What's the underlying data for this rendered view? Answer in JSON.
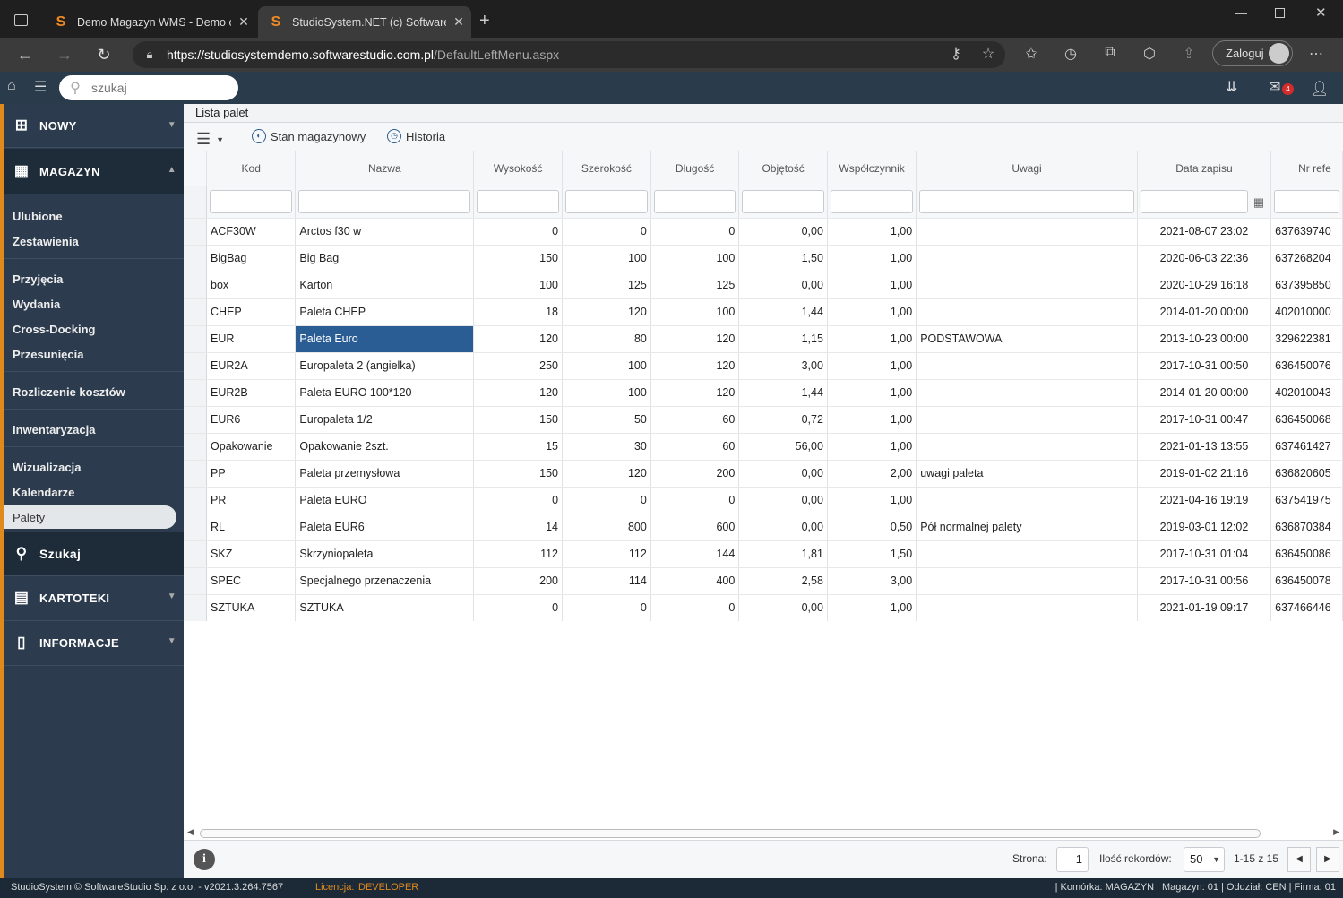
{
  "browser": {
    "tabs": [
      {
        "title": "Demo Magazyn WMS - Demo o",
        "icon": "studiosystem-logo-icon"
      },
      {
        "title": "StudioSystem.NET (c) SoftwareSt",
        "icon": "studiosystem-logo-icon"
      }
    ],
    "url_host": "https://studiosystemdemo.softwarestudio.com.pl",
    "url_path": "/DefaultLeftMenu.aspx",
    "login_label": "Zaloguj"
  },
  "app": {
    "search_placeholder": "szukaj",
    "mail_badge": "4"
  },
  "sidebar": {
    "nowy": "NOWY",
    "magazyn": "MAGAZYN",
    "items": [
      "Ulubione",
      "Zestawienia",
      "Przyjęcia",
      "Wydania",
      "Cross-Docking",
      "Przesunięcia",
      "Rozliczenie kosztów",
      "Inwentaryzacja",
      "Wizualizacja",
      "Kalendarze",
      "Palety"
    ],
    "szukaj": "Szukaj",
    "kartoteki": "KARTOTEKI",
    "informacje": "INFORMACJE"
  },
  "page": {
    "title": "Lista palet",
    "toolbar": {
      "stan": "Stan magazynowy",
      "historia": "Historia"
    }
  },
  "grid": {
    "columns": [
      "Kod",
      "Nazwa",
      "Wysokość",
      "Szerokość",
      "Długość",
      "Objętość",
      "Współczynnik",
      "Uwagi",
      "Data zapisu",
      "Nr refe"
    ],
    "rows": [
      [
        "ACF30W",
        "Arctos f30 w",
        "0",
        "0",
        "0",
        "0,00",
        "1,00",
        "",
        "2021-08-07 23:02",
        "637639740"
      ],
      [
        "BigBag",
        "Big Bag",
        "150",
        "100",
        "100",
        "1,50",
        "1,00",
        "",
        "2020-06-03 22:36",
        "637268204"
      ],
      [
        "box",
        "Karton",
        "100",
        "125",
        "125",
        "0,00",
        "1,00",
        "",
        "2020-10-29 16:18",
        "637395850"
      ],
      [
        "CHEP",
        "Paleta CHEP",
        "18",
        "120",
        "100",
        "1,44",
        "1,00",
        "",
        "2014-01-20 00:00",
        "402010000"
      ],
      [
        "EUR",
        "Paleta Euro",
        "120",
        "80",
        "120",
        "1,15",
        "1,00",
        "PODSTAWOWA",
        "2013-10-23 00:00",
        "329622381"
      ],
      [
        "EUR2A",
        "Europaleta 2 (angielka)",
        "250",
        "100",
        "120",
        "3,00",
        "1,00",
        "",
        "2017-10-31 00:50",
        "636450076"
      ],
      [
        "EUR2B",
        "Paleta EURO 100*120",
        "120",
        "100",
        "120",
        "1,44",
        "1,00",
        "",
        "2014-01-20 00:00",
        "402010043"
      ],
      [
        "EUR6",
        "Europaleta 1/2",
        "150",
        "50",
        "60",
        "0,72",
        "1,00",
        "",
        "2017-10-31 00:47",
        "636450068"
      ],
      [
        "Opakowanie",
        "Opakowanie 2szt.",
        "15",
        "30",
        "60",
        "56,00",
        "1,00",
        "",
        "2021-01-13 13:55",
        "637461427"
      ],
      [
        "PP",
        "Paleta przemysłowa",
        "150",
        "120",
        "200",
        "0,00",
        "2,00",
        "uwagi paleta",
        "2019-01-02 21:16",
        "636820605"
      ],
      [
        "PR",
        "Paleta EURO",
        "0",
        "0",
        "0",
        "0,00",
        "1,00",
        "",
        "2021-04-16 19:19",
        "637541975"
      ],
      [
        "RL",
        "Paleta EUR6",
        "14",
        "800",
        "600",
        "0,00",
        "0,50",
        "Pół normalnej palety",
        "2019-03-01 12:02",
        "636870384"
      ],
      [
        "SKZ",
        "Skrzyniopaleta",
        "112",
        "112",
        "144",
        "1,81",
        "1,50",
        "",
        "2017-10-31 01:04",
        "636450086"
      ],
      [
        "SPEC",
        "Specjalnego przenaczenia",
        "200",
        "114",
        "400",
        "2,58",
        "3,00",
        "",
        "2017-10-31 00:56",
        "636450078"
      ],
      [
        "SZTUKA",
        "SZTUKA",
        "0",
        "0",
        "0",
        "0,00",
        "1,00",
        "",
        "2021-01-19 09:17",
        "637466446"
      ]
    ],
    "selected_row": 4
  },
  "footer": {
    "strona_label": "Strona:",
    "strona_value": "1",
    "ilosc_label": "Ilość rekordów:",
    "ilosc_value": "50",
    "range": "1-15 z 15"
  },
  "status": {
    "copyright": "StudioSystem © SoftwareStudio Sp. z o.o. - v2021.3.264.7567",
    "licencja_label": "Licencja:",
    "licencja_value": "DEVELOPER",
    "right": "| Komórka: MAGAZYN | Magazyn: 01 | Oddział: CEN | Firma: 01"
  }
}
